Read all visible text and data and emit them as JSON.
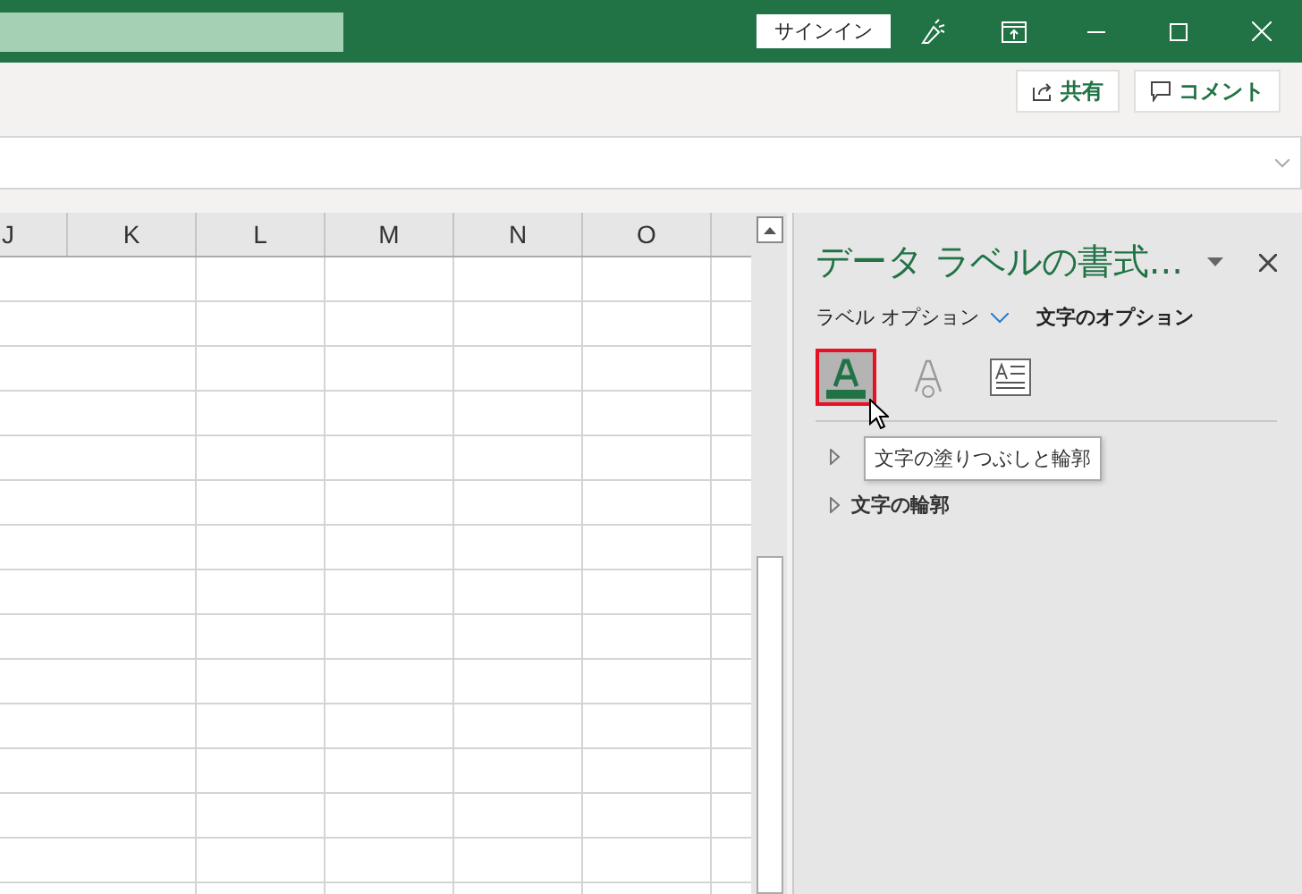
{
  "title_bar": {
    "sign_in": "サインイン"
  },
  "ribbon": {
    "share": "共有",
    "comment": "コメント"
  },
  "sheet": {
    "columns": [
      "J",
      "K",
      "L",
      "M",
      "N",
      "O"
    ]
  },
  "pane": {
    "title": "データ ラベルの書式...",
    "tabs": [
      {
        "label": "ラベル オプション",
        "selected": false
      },
      {
        "label": "文字のオプション",
        "selected": true
      }
    ],
    "icons": [
      {
        "kind": "fill",
        "selected": true
      },
      {
        "kind": "outline",
        "selected": false
      },
      {
        "kind": "textbox",
        "selected": false
      }
    ],
    "tooltip": "文字の塗りつぶしと輪郭",
    "sections": [
      {
        "expanded": false
      },
      {
        "label": "文字の輪郭",
        "expanded": false
      }
    ]
  }
}
